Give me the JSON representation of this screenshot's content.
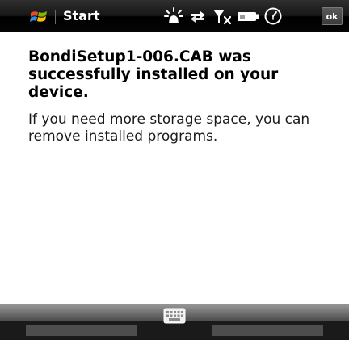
{
  "titlebar": {
    "start_label": "Start",
    "ok_label": "ok",
    "icons": [
      "windows-flag-icon",
      "notification-star-icon",
      "connectivity-arrows-icon",
      "signal-off-icon",
      "battery-icon",
      "clock-icon"
    ]
  },
  "dialog": {
    "heading": "BondiSetup1-006.CAB was successfully installed on your device.",
    "message": "If you need more storage space, you can remove installed programs."
  },
  "menubar": {
    "icons": [
      "keyboard-icon"
    ]
  },
  "colors": {
    "titlebar": "#000000",
    "title_text": "#ffffff",
    "background": "#ffffff",
    "text": "#000000",
    "flag_red": "#e94b2c",
    "flag_green": "#7fba00",
    "flag_blue": "#2e8ee8",
    "flag_yellow": "#fbbc05"
  }
}
